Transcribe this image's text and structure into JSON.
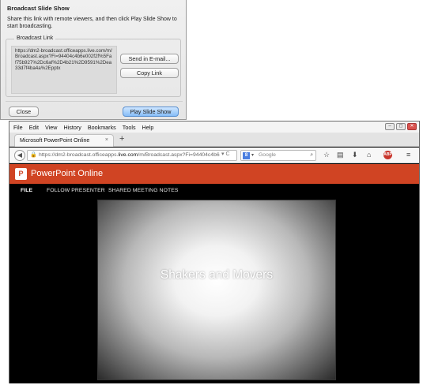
{
  "dialog": {
    "title": "Broadcast Slide Show",
    "description": "Share this link with remote viewers, and then click Play Slide Show to start broadcasting.",
    "fieldset_label": "Broadcast Link",
    "link": "https://dm2-broadcast.officeapps.live.com/m/Broadcast.aspx?Fi=94404c4b6e002f2f%5Fa f75b927%2Dc6af%2D4b21%2D9591%2Dea33d7f4ba4a%2Epptx",
    "send_email_label": "Send in E-mail...",
    "copy_link_label": "Copy Link",
    "close_label": "Close",
    "play_label": "Play Slide Show"
  },
  "browser": {
    "menus": [
      "File",
      "Edit",
      "View",
      "History",
      "Bookmarks",
      "Tools",
      "Help"
    ],
    "tab_title": "Microsoft PowerPoint Online",
    "new_tab": "+",
    "url_prefix": "https://dm2-broadcast.officeapps.",
    "url_host": "live.com",
    "url_suffix": "/m/Broadcast.aspx?Fi=94404c4b6",
    "search_engine": "8",
    "search_placeholder": "Google",
    "window_controls": {
      "minimize": "–",
      "maximize": "◻",
      "close": "✕"
    },
    "icons": [
      "back-arrow-icon",
      "lock-icon",
      "search-icon",
      "star-icon",
      "clipboard-icon",
      "download-icon",
      "home-icon",
      "adblock-icon",
      "menu-icon"
    ],
    "abp_label": "ABP"
  },
  "ppt": {
    "app_title": "PowerPoint Online",
    "logo_letter": "P",
    "nav": {
      "file": "FILE",
      "follow": "FOLLOW PRESENTER",
      "notes": "SHARED MEETING NOTES"
    },
    "slide_title": "Shakers and Movers",
    "accent_color": "#d04423"
  }
}
